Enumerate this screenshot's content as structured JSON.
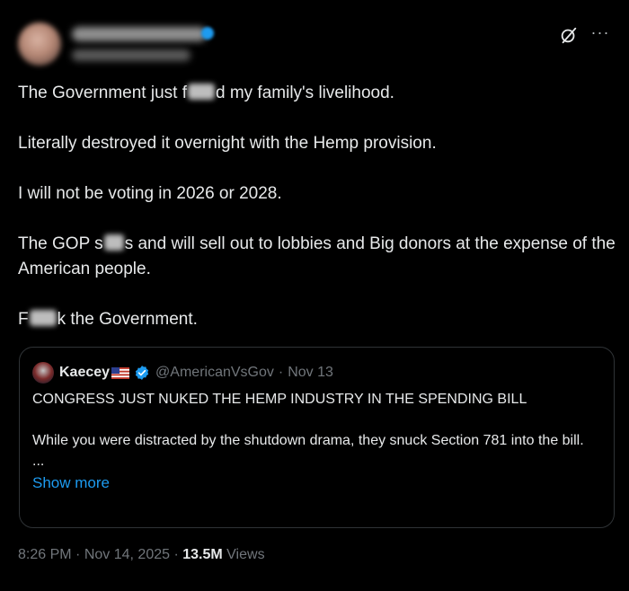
{
  "tweet": {
    "lines": [
      {
        "before": "The Government just f",
        "after": "d my family's livelihood."
      },
      {
        "text": "Literally destroyed it overnight with the Hemp provision."
      },
      {
        "text": "I will not be voting in 2026 or 2028."
      },
      {
        "before": "The GOP s",
        "after": "s and will sell out to lobbies and Big donors at the expense of the American people."
      },
      {
        "before": "F",
        "after": "k the Government."
      }
    ],
    "time": "8:26 PM",
    "date": "Nov 14, 2025",
    "views_count": "13.5M",
    "views_label": "Views",
    "separator": "·",
    "more_glyph": "···"
  },
  "quote": {
    "name": "Kaecey",
    "handle": "@AmericanVsGov",
    "date": "Nov 13",
    "separator": "·",
    "line1": "CONGRESS JUST NUKED THE HEMP INDUSTRY IN THE SPENDING BILL",
    "line2": "While you were distracted by the shutdown drama, they snuck Section 781 into the bill.",
    "ellipsis": "...",
    "show_more": "Show more"
  },
  "colors": {
    "background": "#000000",
    "text": "#e7e9ea",
    "muted": "#71767b",
    "link": "#1d9bf0",
    "border": "#2f3336"
  }
}
